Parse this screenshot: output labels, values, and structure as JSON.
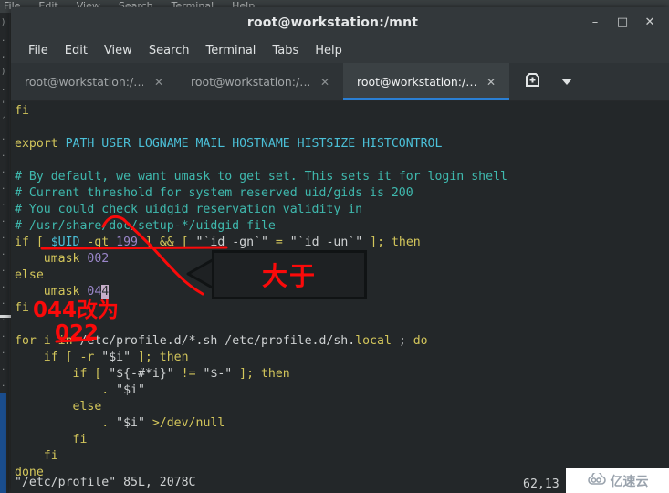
{
  "background_window": {
    "menu_items": [
      "File",
      "Edit",
      "View",
      "Search",
      "Terminal",
      "Help"
    ]
  },
  "window": {
    "title": "root@workstation:/mnt",
    "controls": {
      "minimize": "–",
      "maximize": "□",
      "close": "✕"
    }
  },
  "menubar": {
    "items": [
      "File",
      "Edit",
      "View",
      "Search",
      "Terminal",
      "Tabs",
      "Help"
    ]
  },
  "tabs": {
    "items": [
      {
        "label": "root@workstation:/…",
        "close": "✕",
        "active": false
      },
      {
        "label": "root@workstation:/…",
        "close": "✕",
        "active": false
      },
      {
        "label": "root@workstation:/…",
        "close": "✕",
        "active": true
      }
    ],
    "new_tab_icon": "new-tab-icon",
    "tab_list_icon": "chevron-down-icon"
  },
  "terminal": {
    "lines": [
      [
        {
          "t": "fi",
          "c": "y"
        }
      ],
      [],
      [
        {
          "t": "export ",
          "c": "y"
        },
        {
          "t": "PATH USER LOGNAME MAIL HOSTNAME HISTSIZE HISTCONTROL",
          "c": "b"
        }
      ],
      [],
      [
        {
          "t": "# By default, we want umask to get set. This sets it for login shell",
          "c": "c"
        }
      ],
      [
        {
          "t": "# Current threshold for system reserved uid/gids is 200",
          "c": "c"
        }
      ],
      [
        {
          "t": "# You could check uidgid reservation validity in",
          "c": "c"
        }
      ],
      [
        {
          "t": "# /usr/share/doc/setup-*/uidgid file",
          "c": "c"
        }
      ],
      [
        {
          "t": "if [ ",
          "c": "y"
        },
        {
          "t": "$UID",
          "c": "b"
        },
        {
          "t": " -gt ",
          "c": "y"
        },
        {
          "t": "199",
          "c": "m"
        },
        {
          "t": " ] ",
          "c": "y"
        },
        {
          "t": "&&",
          "c": "y"
        },
        {
          "t": " [ ",
          "c": "y"
        },
        {
          "t": "\"`id -gn`\"",
          "c": "w"
        },
        {
          "t": " = ",
          "c": "y"
        },
        {
          "t": "\"`id -un`\"",
          "c": "w"
        },
        {
          "t": " ]; ",
          "c": "y"
        },
        {
          "t": "then",
          "c": "y"
        }
      ],
      [
        {
          "t": "    umask ",
          "c": "y"
        },
        {
          "t": "002",
          "c": "m"
        }
      ],
      [
        {
          "t": "else",
          "c": "y"
        }
      ],
      [
        {
          "t": "    umask ",
          "c": "y"
        },
        {
          "t": "04",
          "c": "m"
        },
        {
          "t": "4",
          "c": "cursor"
        }
      ],
      [
        {
          "t": "fi",
          "c": "y"
        }
      ],
      [],
      [
        {
          "t": "for i ",
          "c": "y"
        },
        {
          "t": "in",
          "c": "y"
        },
        {
          "t": " /etc/profile.d/*.sh /etc/profile.d/sh.",
          "c": "w"
        },
        {
          "t": "local",
          "c": "y"
        },
        {
          "t": " ; ",
          "c": "w"
        },
        {
          "t": "do",
          "c": "y"
        }
      ],
      [
        {
          "t": "    if [ -r ",
          "c": "y"
        },
        {
          "t": "\"$i\"",
          "c": "w"
        },
        {
          "t": " ]; then",
          "c": "y"
        }
      ],
      [
        {
          "t": "        if [ ",
          "c": "y"
        },
        {
          "t": "\"${-#*i}\"",
          "c": "w"
        },
        {
          "t": " != ",
          "c": "y"
        },
        {
          "t": "\"$-\"",
          "c": "w"
        },
        {
          "t": " ]; then",
          "c": "y"
        }
      ],
      [
        {
          "t": "            . ",
          "c": "y"
        },
        {
          "t": "\"$i\"",
          "c": "w"
        }
      ],
      [
        {
          "t": "        else",
          "c": "y"
        }
      ],
      [
        {
          "t": "            . ",
          "c": "y"
        },
        {
          "t": "\"$i\"",
          "c": "w"
        },
        {
          "t": " >/dev/null",
          "c": "y"
        }
      ],
      [
        {
          "t": "        fi",
          "c": "y"
        }
      ],
      [
        {
          "t": "    fi",
          "c": "y"
        }
      ],
      [
        {
          "t": "done",
          "c": "y"
        }
      ]
    ],
    "status_file": "\"/etc/profile\" 85L, 2078C",
    "status_position": "62,13"
  },
  "annotations": {
    "handwritten_044": "044改为",
    "handwritten_022": "022",
    "callout_text": "大于"
  },
  "watermark": {
    "text": "亿速云",
    "icon": "cloud-icon"
  },
  "colors": {
    "accent_blue": "#2a7fd4",
    "annotation_red": "#fb0a0a",
    "terminal_bg": "#232729",
    "cursor_highlight": "#c6aec9"
  }
}
